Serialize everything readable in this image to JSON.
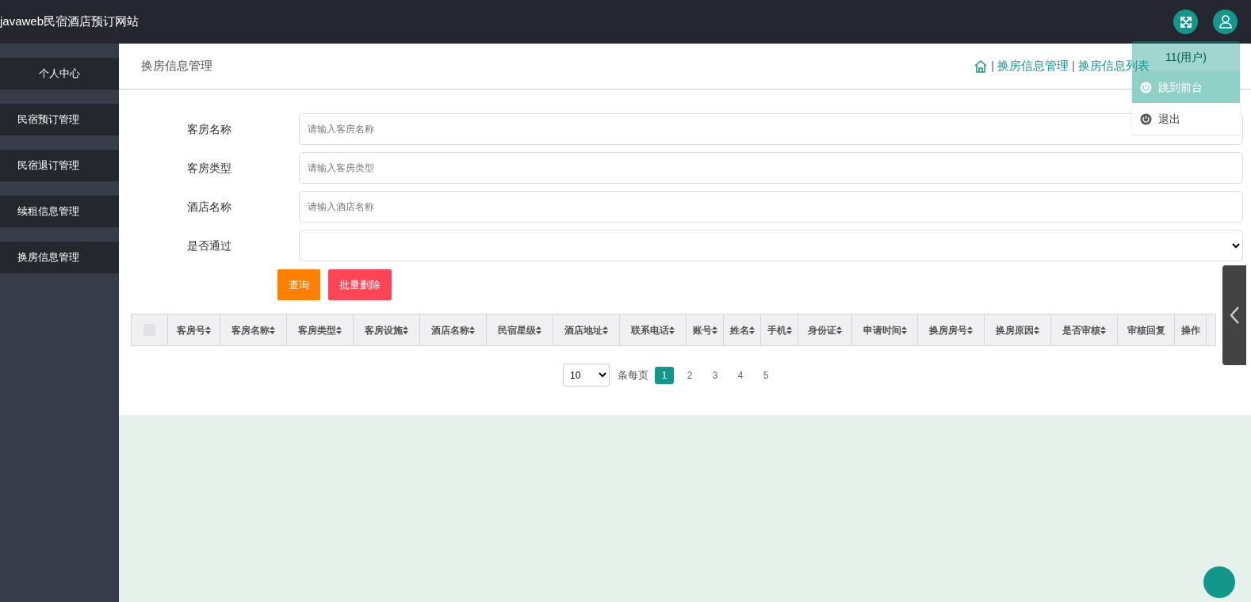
{
  "header": {
    "title": "javaweb民宿酒店预订网站"
  },
  "sidebar": {
    "items": [
      {
        "label": "个人中心"
      },
      {
        "label": "民宿预订管理"
      },
      {
        "label": "民宿退订管理"
      },
      {
        "label": "续租信息管理"
      },
      {
        "label": "换房信息管理"
      }
    ]
  },
  "page_title": "换房信息管理",
  "breadcrumb": [
    {
      "separator": "|",
      "label": "换房信息管理"
    },
    {
      "separator": "|",
      "label": "换房信息列表"
    }
  ],
  "user_menu": {
    "user": "11(用户)",
    "items": [
      {
        "label": "跳到前台",
        "selected": true
      },
      {
        "label": "退出",
        "selected": false
      }
    ]
  },
  "form": {
    "fields": [
      {
        "label": "客房名称",
        "kind": "input",
        "placeholder": "请输入客房名称"
      },
      {
        "label": "客房类型",
        "kind": "input",
        "placeholder": "请输入客房类型"
      },
      {
        "label": "酒店名称",
        "kind": "input",
        "placeholder": "请输入酒店名称"
      },
      {
        "label": "是否通过",
        "kind": "select"
      }
    ],
    "buttons": [
      {
        "label": "查询",
        "kind": "search"
      },
      {
        "label": "批量删除",
        "kind": "delete"
      }
    ]
  },
  "table": {
    "select_all_checked": false,
    "columns": [
      {
        "label": "客房号",
        "sortable": true
      },
      {
        "label": "客房名称",
        "sortable": true
      },
      {
        "label": "客房类型",
        "sortable": true
      },
      {
        "label": "客房设施",
        "sortable": true
      },
      {
        "label": "酒店名称",
        "sortable": true
      },
      {
        "label": "民宿星级",
        "sortable": true
      },
      {
        "label": "酒店地址",
        "sortable": true
      },
      {
        "label": "联系电话",
        "sortable": true
      },
      {
        "label": "账号",
        "sortable": true
      },
      {
        "label": "姓名",
        "sortable": true
      },
      {
        "label": "手机",
        "sortable": true
      },
      {
        "label": "身份证",
        "sortable": true
      },
      {
        "label": "申请时间",
        "sortable": true
      },
      {
        "label": "换房房号",
        "sortable": true
      },
      {
        "label": "换房原因",
        "sortable": true
      },
      {
        "label": "是否审核",
        "sortable": true
      },
      {
        "label": "审核回复",
        "sortable": false
      },
      {
        "label": "操作",
        "sortable": false
      }
    ]
  },
  "pagination": {
    "page_size": "10",
    "per_page_label": "条每页",
    "pages": [
      {
        "label": "1",
        "selected": true
      },
      {
        "label": "2",
        "selected": false
      },
      {
        "label": "3",
        "selected": false
      },
      {
        "label": "4",
        "selected": false
      },
      {
        "label": "5",
        "selected": false
      }
    ]
  }
}
